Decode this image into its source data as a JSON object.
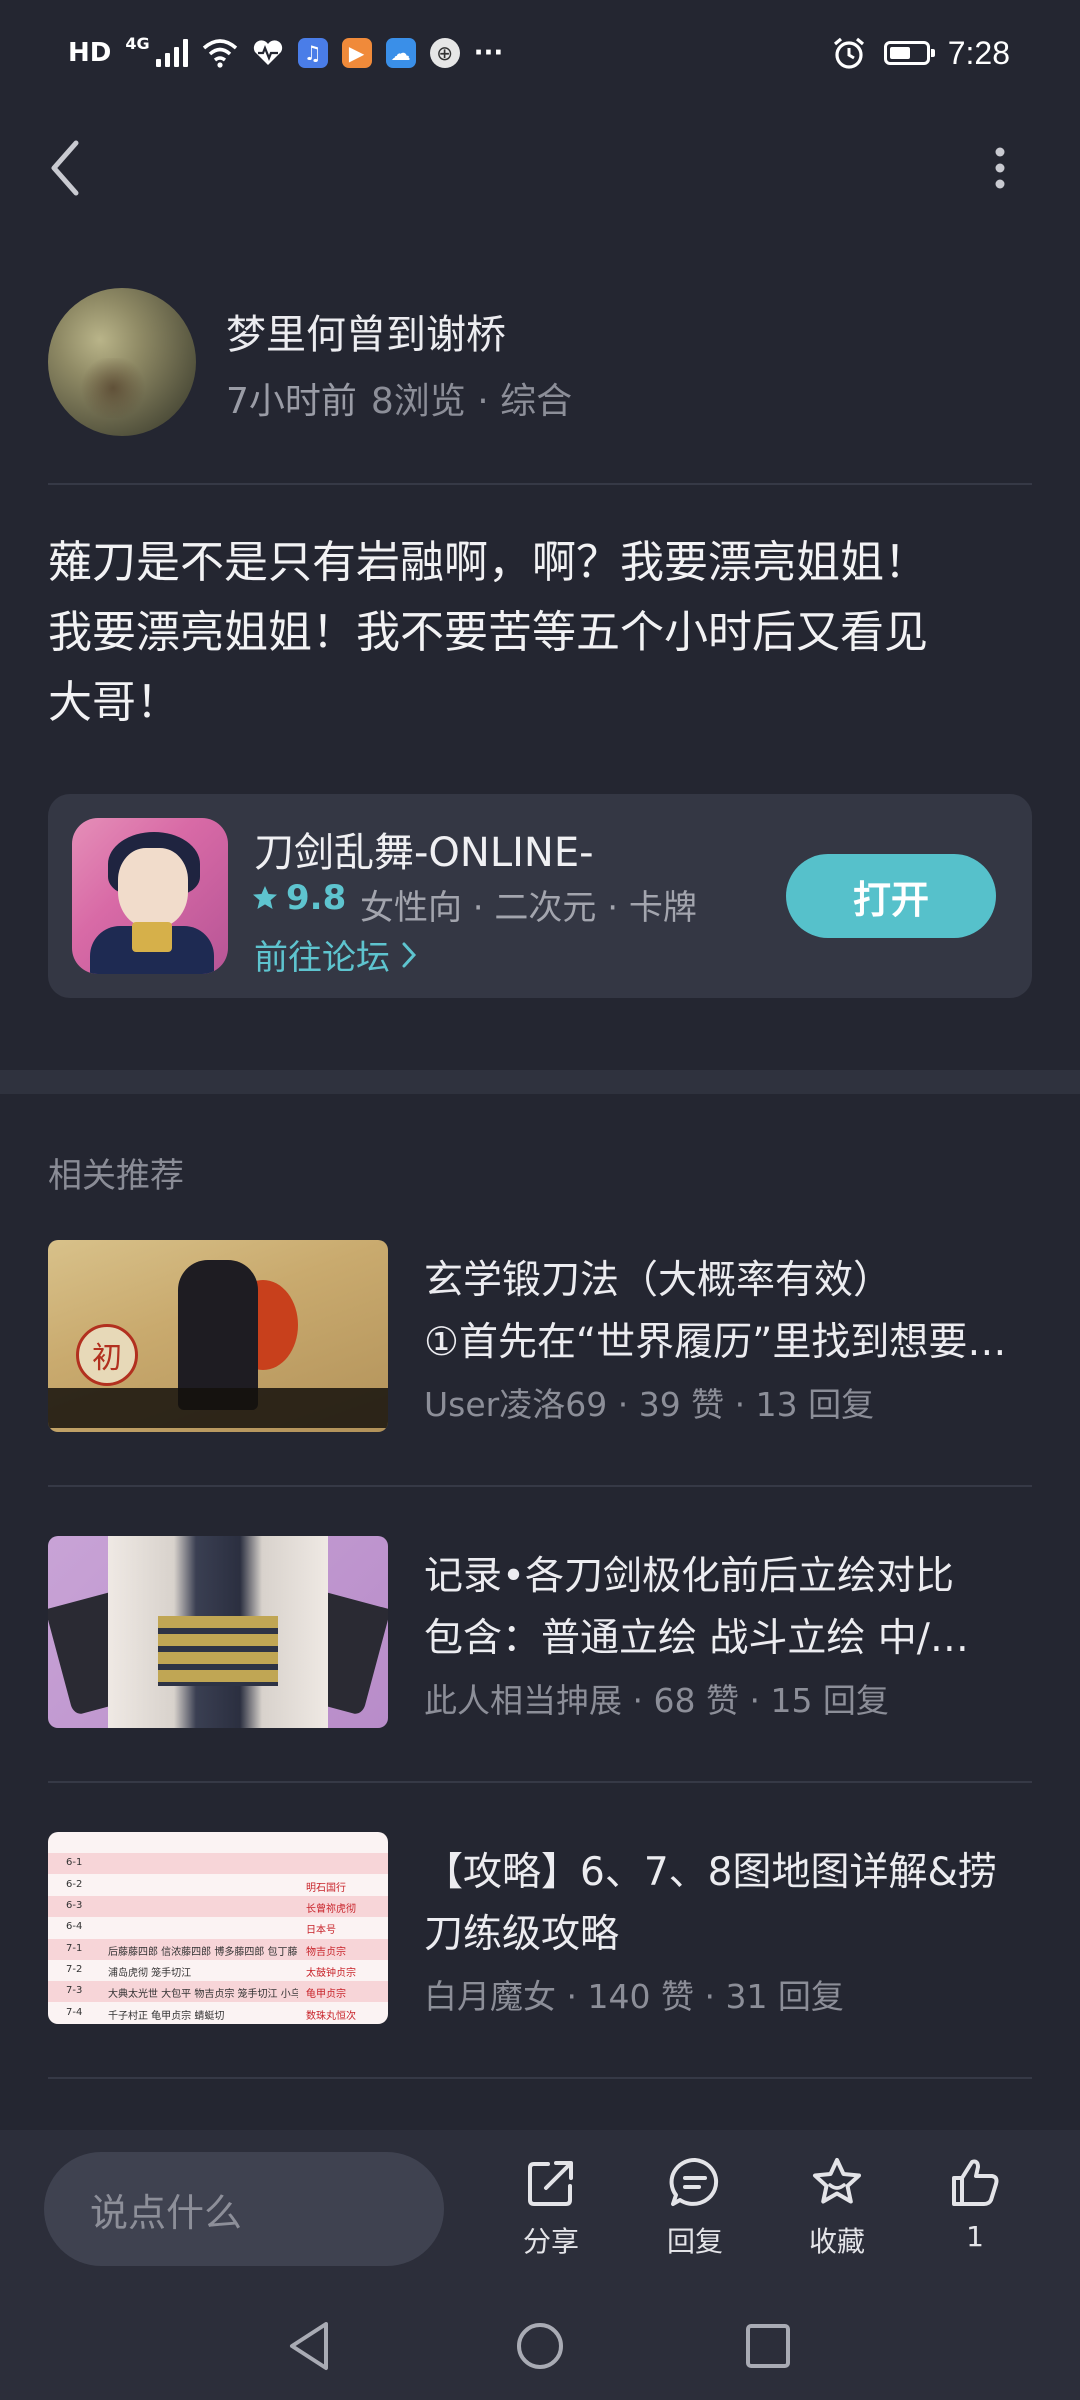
{
  "status_bar": {
    "hd": "HD",
    "net": "4G",
    "time": "7:28",
    "more": "···"
  },
  "post": {
    "author": "梦里何曾到谢桥",
    "time_ago": "7小时前",
    "views": "8浏览",
    "category": "综合",
    "content_lines": [
      "薙刀是不是只有岩融啊，啊？我要漂亮姐姐！",
      "我要漂亮姐姐！我不要苦等五个小时后又看见",
      "大哥！"
    ]
  },
  "game_card": {
    "title": "刀剑乱舞-ONLINE-",
    "rating": "9.8",
    "tags": "女性向 · 二次元 · 卡牌",
    "forum_link": "前往论坛",
    "open_button": "打开"
  },
  "recommendations": {
    "section_title": "相关推荐",
    "items": [
      {
        "title_line1": "玄学锻刀法（大概率有效）",
        "title_line2": "①首先在“世界履历”里找到想要…",
        "author": "User凌洛69",
        "likes": "39 赞",
        "replies": "13 回复",
        "thumb_seal": "初"
      },
      {
        "title_line1": "记录•各刀剑极化前后立绘对比",
        "title_line2": "包含：普通立绘 战斗立绘 中/…",
        "author": "此人相当抻展",
        "likes": "68 赞",
        "replies": "15 回复"
      },
      {
        "title_line1": "【攻略】6、7、8图地图详解&捞",
        "title_line2": "刀练级攻略",
        "author": "白月魔女",
        "likes": "140 赞",
        "replies": "31 回复",
        "table_rows": [
          {
            "k": "6-1",
            "v": "",
            "r": ""
          },
          {
            "k": "6-2",
            "v": "",
            "r": "明石国行"
          },
          {
            "k": "6-3",
            "v": "",
            "r": "长曾祢虎彻"
          },
          {
            "k": "6-4",
            "v": "",
            "r": "日本号"
          },
          {
            "k": "7-1",
            "v": "后藤藤四郎 信浓藤四郎 博多藤四郎 包丁藤四郎 浦岛虎彻",
            "r": "物吉贞宗"
          },
          {
            "k": "7-2",
            "v": "浦岛虎彻 笼手切江",
            "r": "太鼓钟贞宗"
          },
          {
            "k": "7-3",
            "v": "大典太光世 大包平 物吉贞宗 笼手切江 小乌丸",
            "r": "龟甲贞宗"
          },
          {
            "k": "7-4",
            "v": "千子村正 龟甲贞宗 蜻蜓切",
            "r": "数珠丸恒次"
          }
        ]
      }
    ]
  },
  "bottom_bar": {
    "comment_placeholder": "说点什么",
    "share": "分享",
    "reply": "回复",
    "favorite": "收藏",
    "like_count": "1"
  },
  "colors": {
    "background": "#242631",
    "accent": "#56c1cb",
    "card": "#343744"
  }
}
